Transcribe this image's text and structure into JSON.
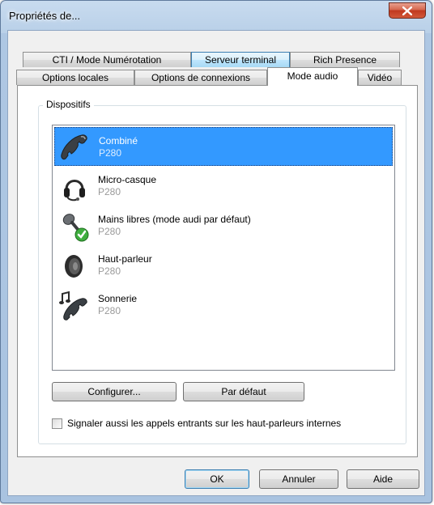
{
  "window": {
    "title": "Propriétés de..."
  },
  "tabs_row1": [
    {
      "label": "CTI / Mode Numérotation"
    },
    {
      "label": "Serveur terminal"
    },
    {
      "label": "Rich Presence"
    }
  ],
  "tabs_row2": [
    {
      "label": "Options locales"
    },
    {
      "label": "Options de connexions"
    },
    {
      "label": "Mode audio"
    },
    {
      "label": "Vidéo"
    }
  ],
  "active_tab": "Mode audio",
  "group": {
    "label": "Dispositifs"
  },
  "devices": [
    {
      "name": "Combiné",
      "model": "P280",
      "icon": "handset-icon",
      "selected": true
    },
    {
      "name": "Micro-casque",
      "model": "P280",
      "icon": "headset-icon"
    },
    {
      "name": "Mains libres (mode audi par défaut)",
      "model": "P280",
      "icon": "microphone-default-icon"
    },
    {
      "name": "Haut-parleur",
      "model": "P280",
      "icon": "speaker-icon"
    },
    {
      "name": "Sonnerie",
      "model": "P280",
      "icon": "ringer-icon"
    }
  ],
  "buttons": {
    "configure": "Configurer...",
    "default": "Par défaut",
    "ok": "OK",
    "cancel": "Annuler",
    "help": "Aide"
  },
  "checkbox": {
    "label": "Signaler aussi les appels entrants sur les haut-parleurs internes",
    "checked": false
  },
  "colors": {
    "selection": "#3399ff",
    "close_button": "#c7432b"
  }
}
